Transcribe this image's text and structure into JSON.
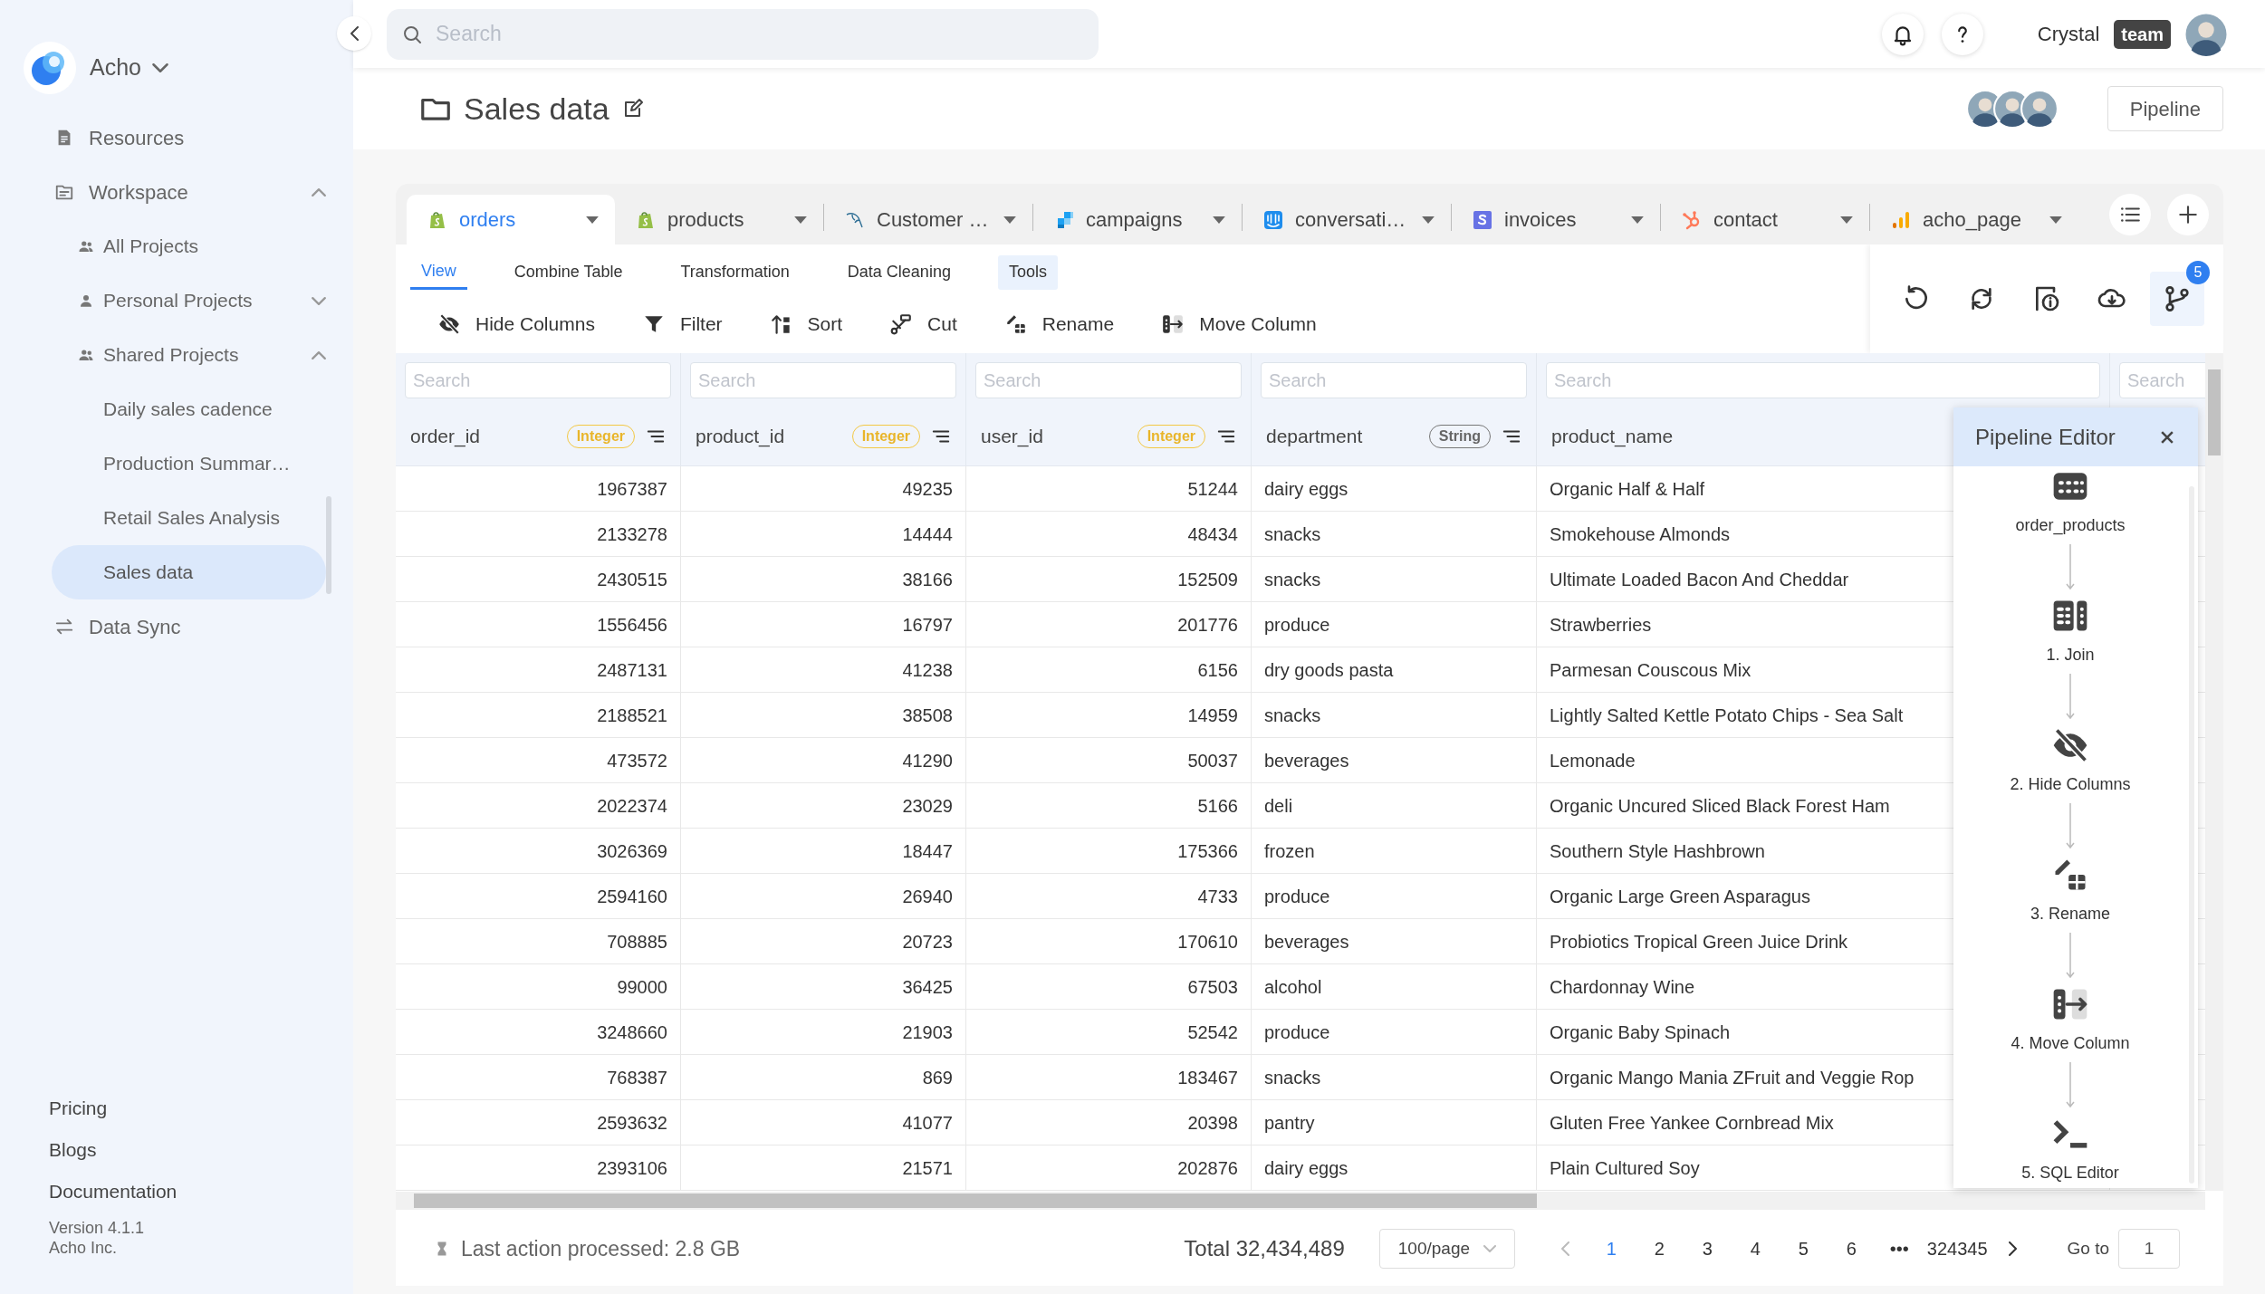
{
  "sidebar": {
    "brand": "Acho",
    "nav": [
      {
        "label": "Resources",
        "selected": false
      },
      {
        "label": "Workspace",
        "selected": false,
        "expanded": true,
        "children": [
          {
            "label": "All Projects",
            "selected": false
          },
          {
            "label": "Personal Projects",
            "selected": false,
            "expanded": false
          },
          {
            "label": "Shared Projects",
            "selected": false,
            "expanded": true,
            "children": [
              {
                "label": "Daily sales cadence",
                "selected": false
              },
              {
                "label": "Production Summar…",
                "selected": false
              },
              {
                "label": "Retail Sales Analysis",
                "selected": false
              },
              {
                "label": "Sales data",
                "selected": true
              }
            ]
          }
        ]
      },
      {
        "label": "Data Sync",
        "selected": false
      }
    ],
    "links": [
      "Pricing",
      "Blogs",
      "Documentation"
    ],
    "version": "Version 4.1.1",
    "company": "Acho Inc."
  },
  "top_bar": {
    "search": {
      "placeholder": "Search"
    },
    "user": "Crystal",
    "badge": "team"
  },
  "page": {
    "title": "Sales data",
    "button": "Pipeline"
  },
  "table_tabs": [
    {
      "label": "orders",
      "selected": true
    },
    {
      "label": "products",
      "selected": false
    },
    {
      "label": "Customer …",
      "selected": false
    },
    {
      "label": "campaigns",
      "selected": false
    },
    {
      "label": "conversati…",
      "selected": false
    },
    {
      "label": "invoices",
      "selected": false
    },
    {
      "label": "contact",
      "selected": false
    },
    {
      "label": "acho_page",
      "selected": false
    }
  ],
  "toolbar_tabs": [
    {
      "label": "View",
      "selected": true,
      "highlighted": false
    },
    {
      "label": "Combine Table",
      "selected": false,
      "highlighted": false
    },
    {
      "label": "Transformation",
      "selected": false,
      "highlighted": false
    },
    {
      "label": "Data Cleaning",
      "selected": false,
      "highlighted": false
    },
    {
      "label": "Tools",
      "selected": false,
      "highlighted": true
    }
  ],
  "actions": [
    "Hide Columns",
    "Filter",
    "Sort",
    "Cut",
    "Rename",
    "Move Column"
  ],
  "tools_badge": "5",
  "columns": [
    {
      "name": "order_id",
      "type": "Integer",
      "placeholder": "Search"
    },
    {
      "name": "product_id",
      "type": "Integer",
      "placeholder": "Search"
    },
    {
      "name": "user_id",
      "type": "Integer",
      "placeholder": "Search"
    },
    {
      "name": "department",
      "type": "String",
      "placeholder": "Search"
    },
    {
      "name": "product_name",
      "placeholder": "Search"
    },
    {
      "placeholder": "Search"
    }
  ],
  "rows": [
    [
      "1967387",
      "49235",
      "51244",
      "dairy eggs",
      "Organic Half & Half"
    ],
    [
      "2133278",
      "14444",
      "48434",
      "snacks",
      "Smokehouse Almonds"
    ],
    [
      "2430515",
      "38166",
      "152509",
      "snacks",
      "Ultimate Loaded Bacon And Cheddar"
    ],
    [
      "1556456",
      "16797",
      "201776",
      "produce",
      "Strawberries"
    ],
    [
      "2487131",
      "41238",
      "6156",
      "dry goods pasta",
      "Parmesan Couscous Mix"
    ],
    [
      "2188521",
      "38508",
      "14959",
      "snacks",
      "Lightly Salted Kettle Potato Chips - Sea Salt"
    ],
    [
      "473572",
      "41290",
      "50037",
      "beverages",
      "Lemonade"
    ],
    [
      "2022374",
      "23029",
      "5166",
      "deli",
      "Organic Uncured Sliced Black Forest Ham"
    ],
    [
      "3026369",
      "18447",
      "175366",
      "frozen",
      "Southern Style Hashbrown"
    ],
    [
      "2594160",
      "26940",
      "4733",
      "produce",
      "Organic Large Green Asparagus"
    ],
    [
      "708885",
      "20723",
      "170610",
      "beverages",
      "Probiotics Tropical Green Juice Drink"
    ],
    [
      "99000",
      "36425",
      "67503",
      "alcohol",
      "Chardonnay Wine"
    ],
    [
      "3248660",
      "21903",
      "52542",
      "produce",
      "Organic Baby Spinach"
    ],
    [
      "768387",
      "869",
      "183467",
      "snacks",
      "Organic Mango Mania ZFruit and Veggie Rop"
    ],
    [
      "2593632",
      "41077",
      "20398",
      "pantry",
      "Gluten Free Yankee Cornbread Mix"
    ],
    [
      "2393106",
      "21571",
      "202876",
      "dairy eggs",
      "Plain Cultured Soy"
    ]
  ],
  "pipeline_editor": {
    "title": "Pipeline Editor",
    "steps": [
      "order_products",
      "1. Join",
      "2. Hide Columns",
      "3. Rename",
      "4. Move Column",
      "5. SQL Editor"
    ]
  },
  "footer": {
    "status": "Last action processed: 2.8 GB",
    "total": "Total 32,434,489",
    "page_size": "100/page",
    "pages": [
      {
        "label": "1",
        "selected": true
      },
      {
        "label": "2",
        "selected": false
      },
      {
        "label": "3",
        "selected": false
      },
      {
        "label": "4",
        "selected": false
      },
      {
        "label": "5",
        "selected": false
      },
      {
        "label": "6",
        "selected": false
      },
      {
        "label": "•••",
        "selected": false
      },
      {
        "label": "324345",
        "selected": false
      }
    ],
    "goto_label": "Go to",
    "goto_value": "1"
  }
}
